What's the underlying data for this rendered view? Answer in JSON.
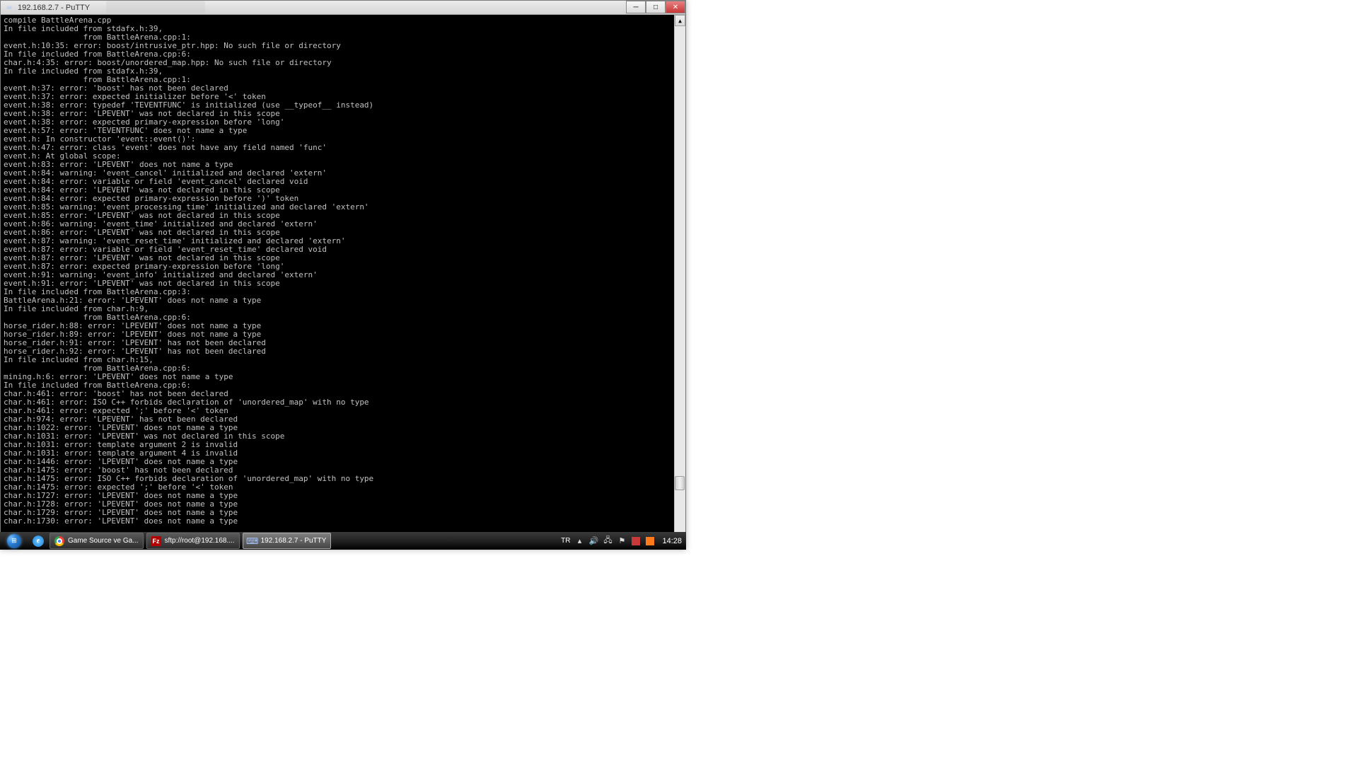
{
  "window": {
    "title": "192.168.2.7 - PuTTY"
  },
  "terminal_lines": [
    "compile BattleArena.cpp",
    "In file included from stdafx.h:39,",
    "                 from BattleArena.cpp:1:",
    "event.h:10:35: error: boost/intrusive_ptr.hpp: No such file or directory",
    "In file included from BattleArena.cpp:6:",
    "char.h:4:35: error: boost/unordered_map.hpp: No such file or directory",
    "In file included from stdafx.h:39,",
    "                 from BattleArena.cpp:1:",
    "event.h:37: error: 'boost' has not been declared",
    "event.h:37: error: expected initializer before '<' token",
    "event.h:38: error: typedef 'TEVENTFUNC' is initialized (use __typeof__ instead)",
    "event.h:38: error: 'LPEVENT' was not declared in this scope",
    "event.h:38: error: expected primary-expression before 'long'",
    "event.h:57: error: 'TEVENTFUNC' does not name a type",
    "event.h: In constructor 'event::event()':",
    "event.h:47: error: class 'event' does not have any field named 'func'",
    "event.h: At global scope:",
    "event.h:83: error: 'LPEVENT' does not name a type",
    "event.h:84: warning: 'event_cancel' initialized and declared 'extern'",
    "event.h:84: error: variable or field 'event_cancel' declared void",
    "event.h:84: error: 'LPEVENT' was not declared in this scope",
    "event.h:84: error: expected primary-expression before ')' token",
    "event.h:85: warning: 'event_processing_time' initialized and declared 'extern'",
    "event.h:85: error: 'LPEVENT' was not declared in this scope",
    "event.h:86: warning: 'event_time' initialized and declared 'extern'",
    "event.h:86: error: 'LPEVENT' was not declared in this scope",
    "event.h:87: warning: 'event_reset_time' initialized and declared 'extern'",
    "event.h:87: error: variable or field 'event_reset_time' declared void",
    "event.h:87: error: 'LPEVENT' was not declared in this scope",
    "event.h:87: error: expected primary-expression before 'long'",
    "event.h:91: warning: 'event_info' initialized and declared 'extern'",
    "event.h:91: error: 'LPEVENT' was not declared in this scope",
    "In file included from BattleArena.cpp:3:",
    "BattleArena.h:21: error: 'LPEVENT' does not name a type",
    "In file included from char.h:9,",
    "                 from BattleArena.cpp:6:",
    "horse_rider.h:88: error: 'LPEVENT' does not name a type",
    "horse_rider.h:89: error: 'LPEVENT' does not name a type",
    "horse_rider.h:91: error: 'LPEVENT' has not been declared",
    "horse_rider.h:92: error: 'LPEVENT' has not been declared",
    "In file included from char.h:15,",
    "                 from BattleArena.cpp:6:",
    "mining.h:6: error: 'LPEVENT' does not name a type",
    "In file included from BattleArena.cpp:6:",
    "char.h:461: error: 'boost' has not been declared",
    "char.h:461: error: ISO C++ forbids declaration of 'unordered_map' with no type",
    "char.h:461: error: expected ';' before '<' token",
    "char.h:974: error: 'LPEVENT' has not been declared",
    "char.h:1022: error: 'LPEVENT' does not name a type",
    "char.h:1031: error: 'LPEVENT' was not declared in this scope",
    "char.h:1031: error: template argument 2 is invalid",
    "char.h:1031: error: template argument 4 is invalid",
    "char.h:1446: error: 'LPEVENT' does not name a type",
    "char.h:1475: error: 'boost' has not been declared",
    "char.h:1475: error: ISO C++ forbids declaration of 'unordered_map' with no type",
    "char.h:1475: error: expected ';' before '<' token",
    "char.h:1727: error: 'LPEVENT' does not name a type",
    "char.h:1728: error: 'LPEVENT' does not name a type",
    "char.h:1729: error: 'LPEVENT' does not name a type",
    "char.h:1730: error: 'LPEVENT' does not name a type"
  ],
  "taskbar": {
    "items": [
      {
        "label": "Game Source ve Ga..."
      },
      {
        "label": "sftp://root@192.168...."
      },
      {
        "label": "192.168.2.7 - PuTTY"
      }
    ],
    "lang": "TR",
    "clock": "14:28"
  }
}
